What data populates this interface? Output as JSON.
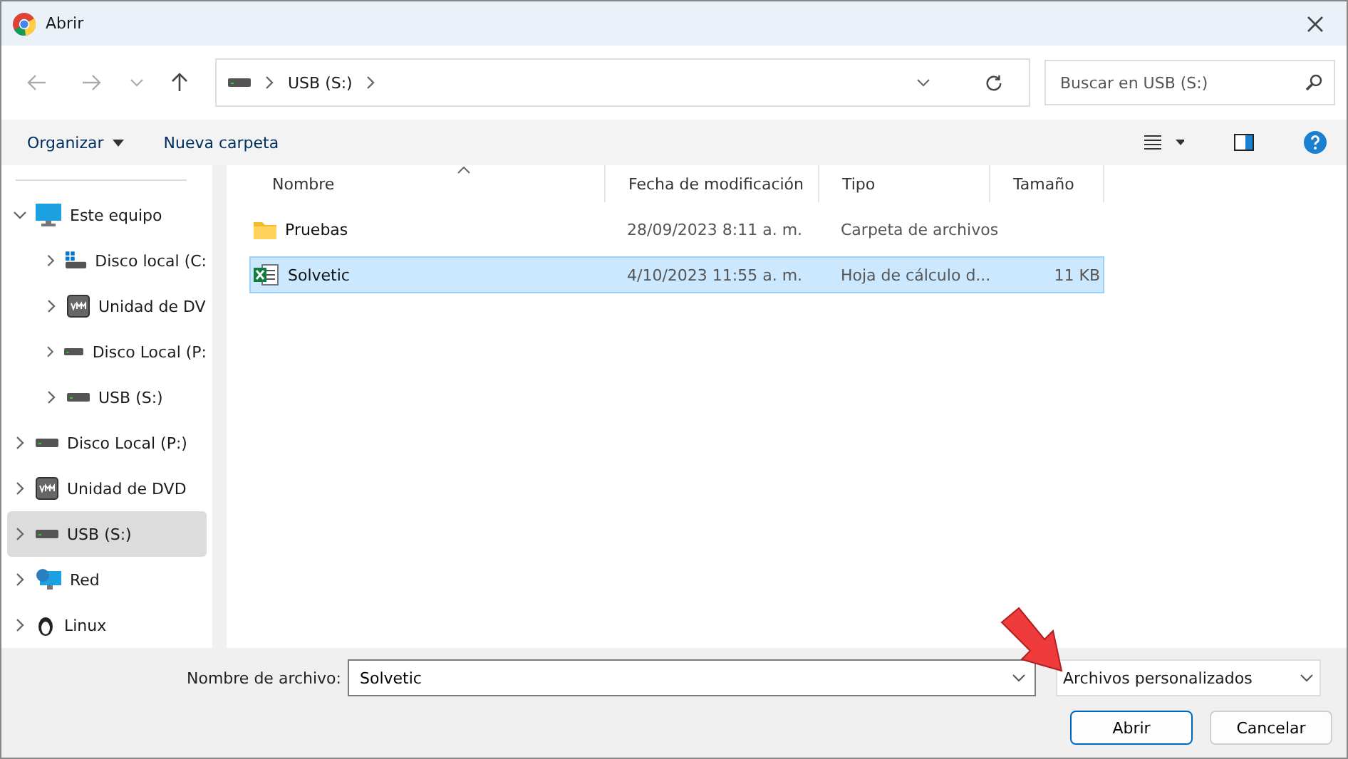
{
  "window": {
    "title": "Abrir"
  },
  "address": {
    "crumbs": [
      "USB (S:)"
    ]
  },
  "search": {
    "placeholder": "Buscar en USB (S:)"
  },
  "toolbar": {
    "organize": "Organizar",
    "new_folder": "Nueva carpeta"
  },
  "sidebar": {
    "items": [
      {
        "label": "Este equipo",
        "kind": "pc",
        "expanded": true,
        "selected": false,
        "children": [
          {
            "label": "Disco local (C:",
            "kind": "system-drive",
            "expanded": false,
            "selected": false
          },
          {
            "label": "Unidad de DV",
            "kind": "vm",
            "expanded": false,
            "selected": false
          },
          {
            "label": "Disco Local (P:",
            "kind": "drive",
            "expanded": false,
            "selected": false
          },
          {
            "label": "USB (S:)",
            "kind": "drive",
            "expanded": false,
            "selected": false
          }
        ]
      },
      {
        "label": "Disco Local (P:)",
        "kind": "drive",
        "expanded": false,
        "selected": false
      },
      {
        "label": "Unidad de DVD",
        "kind": "vm",
        "expanded": false,
        "selected": false
      },
      {
        "label": "USB (S:)",
        "kind": "drive",
        "expanded": false,
        "selected": true
      },
      {
        "label": "Red",
        "kind": "network",
        "expanded": false,
        "selected": false
      },
      {
        "label": "Linux",
        "kind": "linux",
        "expanded": false,
        "selected": false
      }
    ]
  },
  "table": {
    "columns": [
      "Nombre",
      "Fecha de modificación",
      "Tipo",
      "Tamaño"
    ],
    "rows": [
      {
        "name": "Pruebas",
        "kind": "folder",
        "date": "28/09/2023 8:11 a. m.",
        "type": "Carpeta de archivos",
        "size": "",
        "selected": false
      },
      {
        "name": "Solvetic",
        "kind": "spreadsheet",
        "date": "4/10/2023 11:55 a. m.",
        "type": "Hoja de cálculo d...",
        "size": "11 KB",
        "selected": true
      }
    ]
  },
  "footer": {
    "filename_label": "Nombre de archivo:",
    "filename": "Solvetic",
    "filter": "Archivos personalizados",
    "open": "Abrir",
    "cancel": "Cancelar"
  }
}
